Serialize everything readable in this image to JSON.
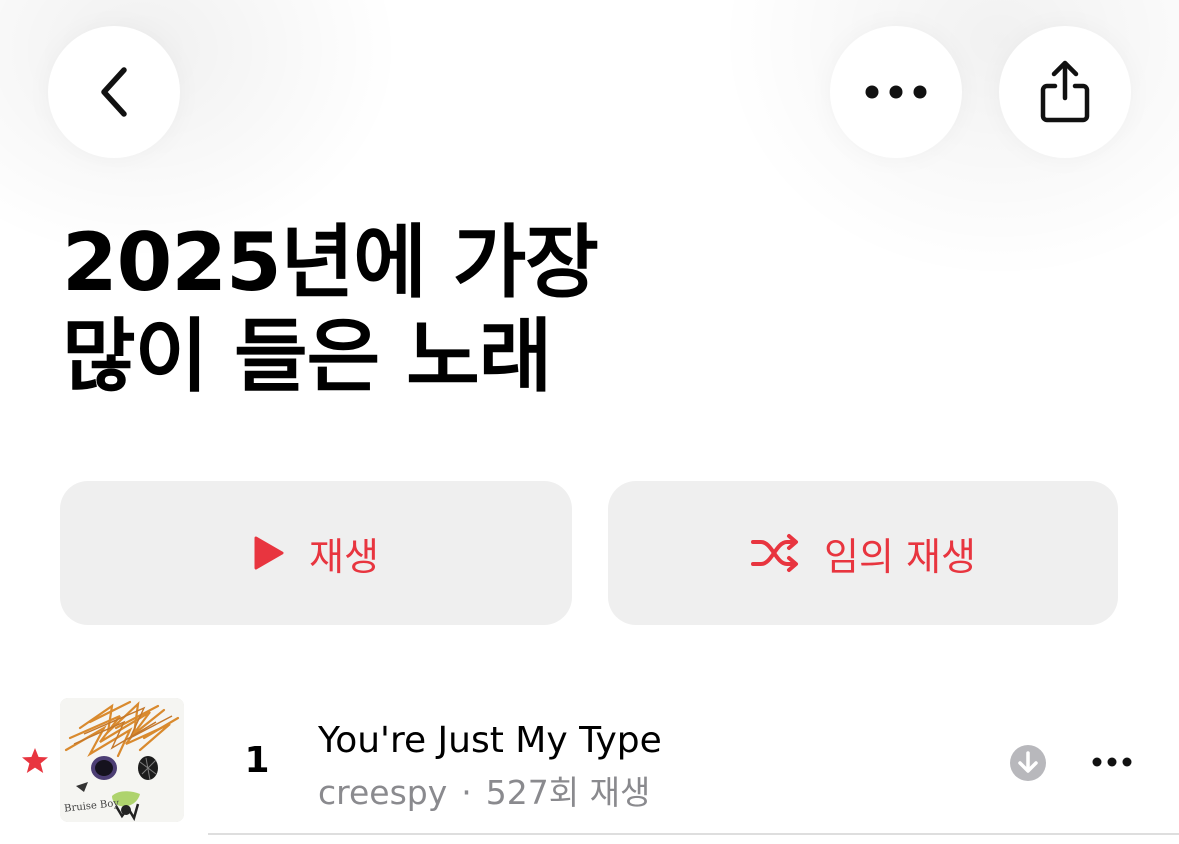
{
  "header": {
    "back_icon": "chevron-left-icon",
    "more_icon": "ellipsis-icon",
    "share_icon": "share-icon"
  },
  "playlist": {
    "title_line1": "2025년에 가장",
    "title_line2": "많이 들은 노래"
  },
  "actions": {
    "play_label": "재생",
    "play_icon": "play-icon",
    "shuffle_label": "임의 재생",
    "shuffle_icon": "shuffle-icon",
    "accent_color": "#e8353f"
  },
  "tracks": [
    {
      "rank": "1",
      "title": "You're Just My Type",
      "artist": "creespy",
      "separator": "·",
      "plays": "527회 재생",
      "favorite_icon": "star-icon",
      "download_icon": "download-icon",
      "more_icon": "ellipsis-icon",
      "artwork_text": "Bruise Boy"
    }
  ]
}
